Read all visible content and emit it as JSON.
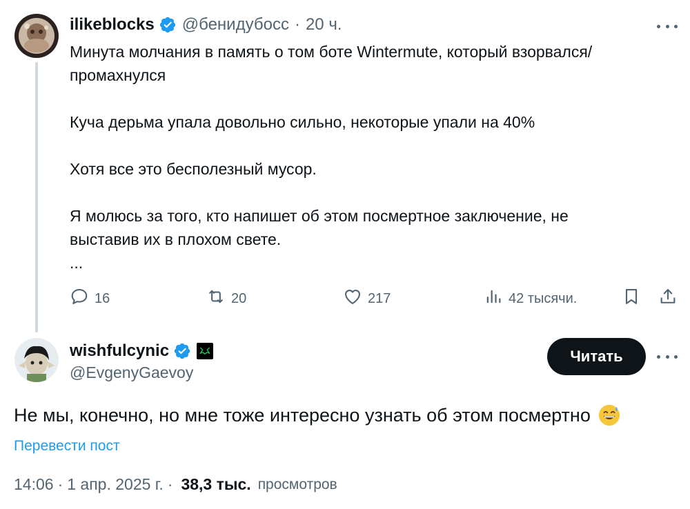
{
  "tweet1": {
    "author_name": "ilikeblocks",
    "handle": "@бенидубосс",
    "separator": "·",
    "time": "20 ч.",
    "text_lines": [
      "Минута молчания в память о том боте Wintermute, который взорвался/",
      "промахнулся",
      "",
      "Куча дерьма упала довольно сильно, некоторые упали на 40%",
      "",
      "Хотя все это бесполезный мусор.",
      "",
      "Я молюсь за того, кто напишет об этом посмертное заключение, не",
      "выставив их в плохом свете.",
      "..."
    ],
    "actions": {
      "replies": "16",
      "reposts": "20",
      "likes": "217",
      "views": "42 тысячи."
    },
    "icons": [
      "verified-badge-icon",
      "more-icon",
      "reply-icon",
      "repost-icon",
      "like-icon",
      "views-icon",
      "bookmark-icon",
      "share-icon"
    ]
  },
  "tweet2": {
    "author_name": "wishfulcynic",
    "handle": "@EvgenyGaevoy",
    "follow_label": "Читать",
    "text": "Не мы, конечно, но мне тоже интересно узнать об этом посмертно",
    "emoji": "grinning-face-with-sweat-icon",
    "translate_label": "Перевести пост",
    "timestamp_time": "14:06",
    "separator": "·",
    "timestamp_date": "1 апр. 2025 г.",
    "views_count": "38,3 тыс.",
    "views_label": "просмотров"
  },
  "colors": {
    "text_primary": "#0f1419",
    "text_secondary": "#536471",
    "accent_blue": "#1d9bf0",
    "thread_line": "#cfd9de",
    "button_bg": "#0f1419"
  }
}
